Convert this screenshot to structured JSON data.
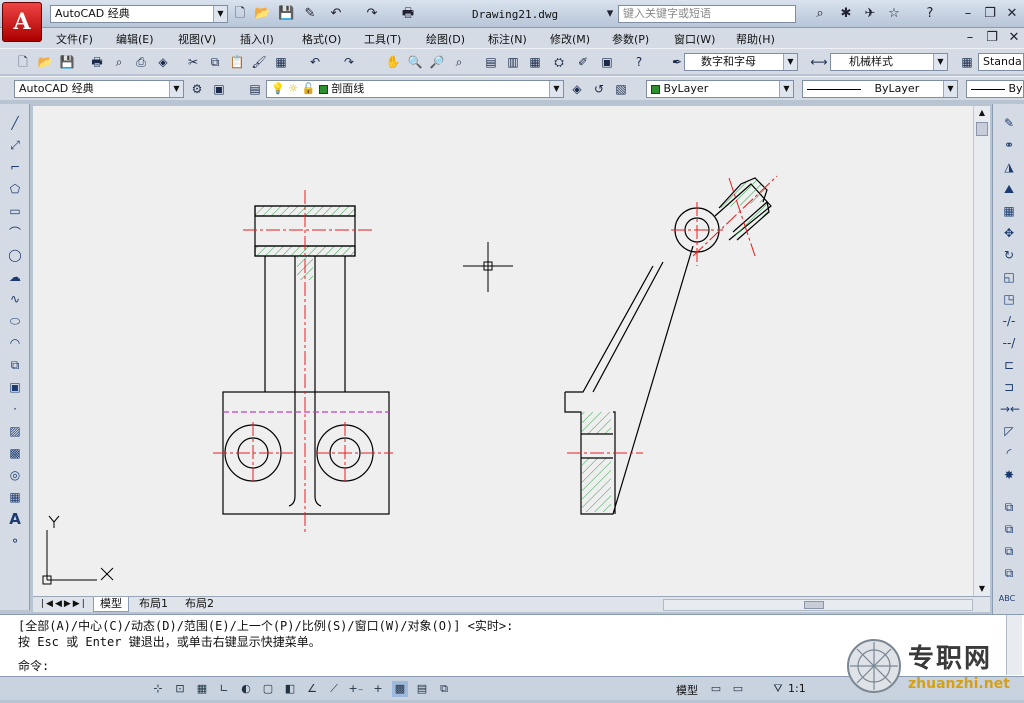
{
  "app": {
    "logo": "A"
  },
  "title": {
    "doc": "Drawing21.dwg",
    "workspace": "AutoCAD 经典",
    "search_placeholder": "键入关键字或短语"
  },
  "menu": [
    "文件(F)",
    "编辑(E)",
    "视图(V)",
    "插入(I)",
    "格式(O)",
    "工具(T)",
    "绘图(D)",
    "标注(N)",
    "修改(M)",
    "参数(P)",
    "窗口(W)",
    "帮助(H)"
  ],
  "toolbar1": {
    "text_style": "数字和字母",
    "dim_style": "机械样式",
    "table_style": "Standa"
  },
  "toolbar2": {
    "workspace": "AutoCAD 经典",
    "layer": "剖面线",
    "color": "ByLayer",
    "linetype": "ByLayer",
    "lineweight": "By"
  },
  "tabs": [
    "模型",
    "布局1",
    "布局2"
  ],
  "command": {
    "line1": "[全部(A)/中心(C)/动态(D)/范围(E)/上一个(P)/比例(S)/窗口(W)/对象(O)] <实时>:",
    "line2": "按 Esc 或 Enter 键退出，或单击右键显示快捷菜单。",
    "prompt": "命令:"
  },
  "status": {
    "model": "模型",
    "scale": "1:1"
  },
  "ucs": {
    "x": "X",
    "y": "Y"
  },
  "watermark": {
    "cn": "专职网",
    "en": "zhuanzhi.net"
  },
  "colors": {
    "red": "#e02020",
    "hatch": "#2fa24a",
    "magenta": "#c040c0",
    "bylayer_swatch": "#2d8f2d",
    "layer_swatch": "#2d8f2d"
  }
}
